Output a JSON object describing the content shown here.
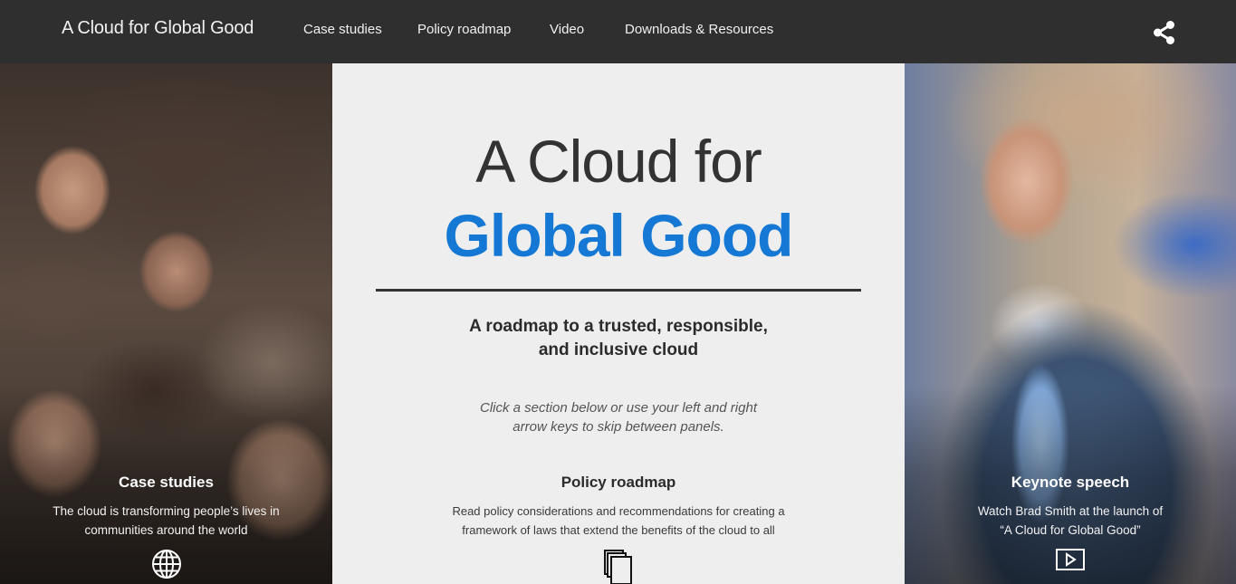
{
  "header": {
    "brand": "A Cloud for Global Good",
    "nav": [
      {
        "label": "Case studies"
      },
      {
        "label": "Policy roadmap"
      },
      {
        "label": "Video"
      },
      {
        "label": "Downloads & Resources"
      }
    ],
    "share_icon": "share-icon"
  },
  "hero": {
    "title_line1": "A Cloud for",
    "title_line2": "Global Good",
    "subtitle_line1": "A roadmap to a trusted, responsible,",
    "subtitle_line2": "and inclusive cloud",
    "hint_line1": "Click a section below or use your left and right",
    "hint_line2": "arrow keys to skip between panels.",
    "accent_color": "#1478d4"
  },
  "panels": [
    {
      "title": "Case studies",
      "desc_line1": "The cloud is transforming people’s lives in",
      "desc_line2": "communities around the world",
      "icon": "globe-icon"
    },
    {
      "title": "Policy roadmap",
      "desc_line1": "Read policy considerations and recommendations for creating a",
      "desc_line2": "framework of laws that extend the benefits of the cloud to all",
      "icon": "documents-icon"
    },
    {
      "title": "Keynote speech",
      "desc_line1": "Watch Brad Smith at the launch of",
      "desc_line2": "“A Cloud for Global Good”",
      "icon": "play-icon"
    }
  ]
}
